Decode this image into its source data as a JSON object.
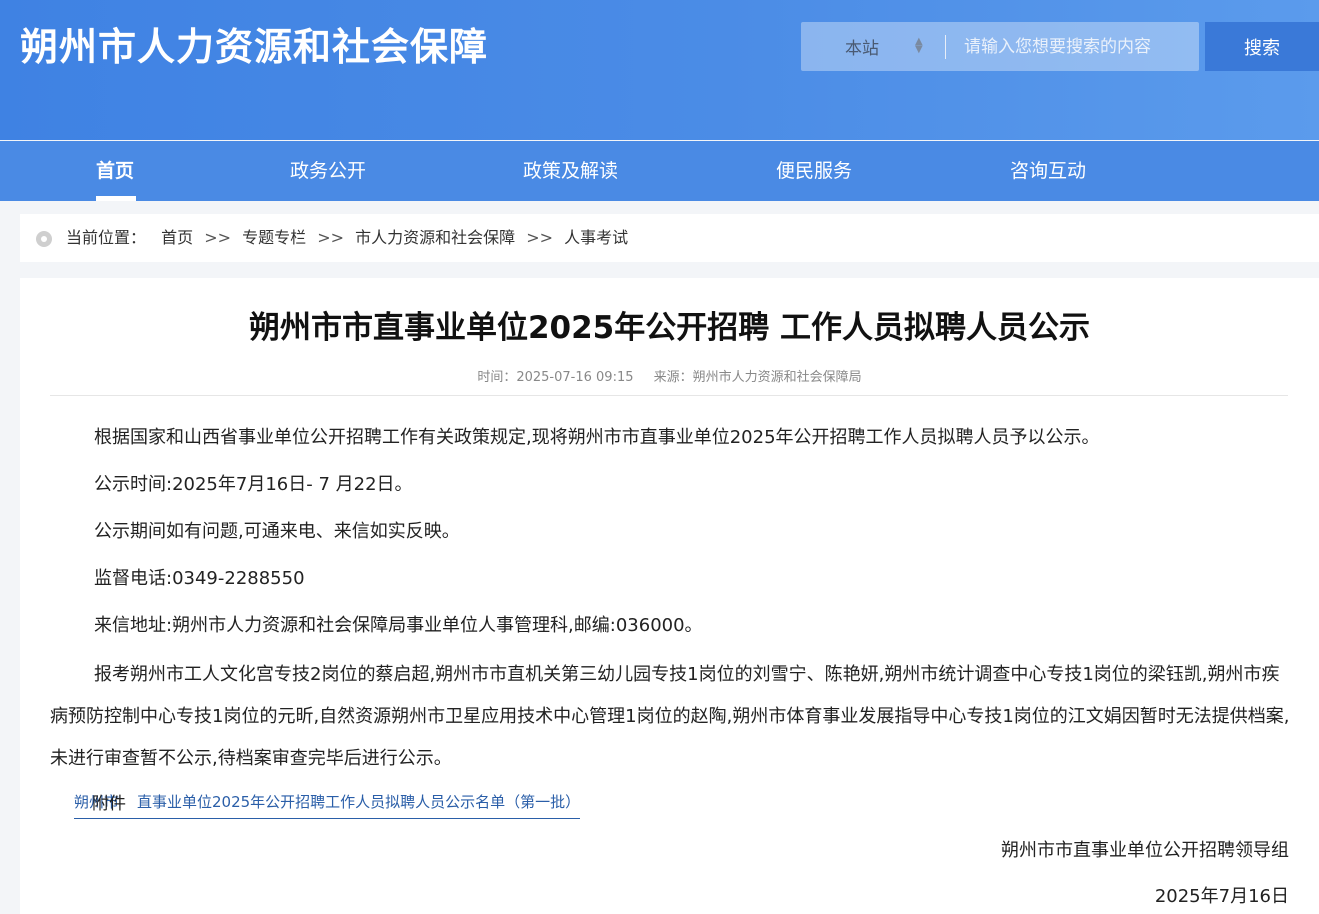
{
  "header": {
    "site_title": "朔州市人力资源和社会保障",
    "search_scope": "本站",
    "search_placeholder": "请输入您想要搜索的内容",
    "search_button": "搜索"
  },
  "nav": {
    "items": [
      {
        "label": "首页"
      },
      {
        "label": "政务公开"
      },
      {
        "label": "政策及解读"
      },
      {
        "label": "便民服务"
      },
      {
        "label": "咨询互动"
      }
    ]
  },
  "breadcrumb": {
    "prefix": "当前位置：",
    "separator": ">>",
    "items": [
      "首页",
      "专题专栏",
      "市人力资源和社会保障",
      "人事考试"
    ]
  },
  "article": {
    "title": "朔州市市直事业单位2025年公开招聘 工作人员拟聘人员公示",
    "time_label": "时间：",
    "time": "2025-07-16 09:15",
    "source_label": "来源：",
    "source": "朔州市人力资源和社会保障局",
    "paragraphs": [
      "根据国家和山西省事业单位公开招聘工作有关政策规定,现将朔州市市直事业单位2025年公开招聘工作人员拟聘人员予以公示。",
      "公示时间:2025年7月16日- 7 月22日。",
      "公示期间如有问题,可通来电、来信如实反映。",
      "监督电话:0349-2288550",
      "来信地址:朔州市人力资源和社会保障局事业单位人事管理科,邮编:036000。",
      "报考朔州市工人文化宫专技2岗位的蔡启超,朔州市市直机关第三幼儿园专技1岗位的刘雪宁、陈艳妍,朔州市统计调查中心专技1岗位的梁钰凯,朔州市疾病预防控制中心专技1岗位的元昕,自然资源朔州市卫星应用技术中心管理1岗位的赵陶,朔州市体育事业发展指导中心专技1岗位的江文娟因暂时无法提供档案,未进行审查暂不公示,待档案审查完毕后进行公示。"
    ],
    "attachment_label": "附件",
    "attachment_prefix": "朔州市",
    "attachment_link": "直事业单位2025年公开招聘工作人员拟聘人员公示名单（第一批）",
    "signature": "朔州市市直事业单位公开招聘领导组",
    "date": "2025年7月16日"
  }
}
